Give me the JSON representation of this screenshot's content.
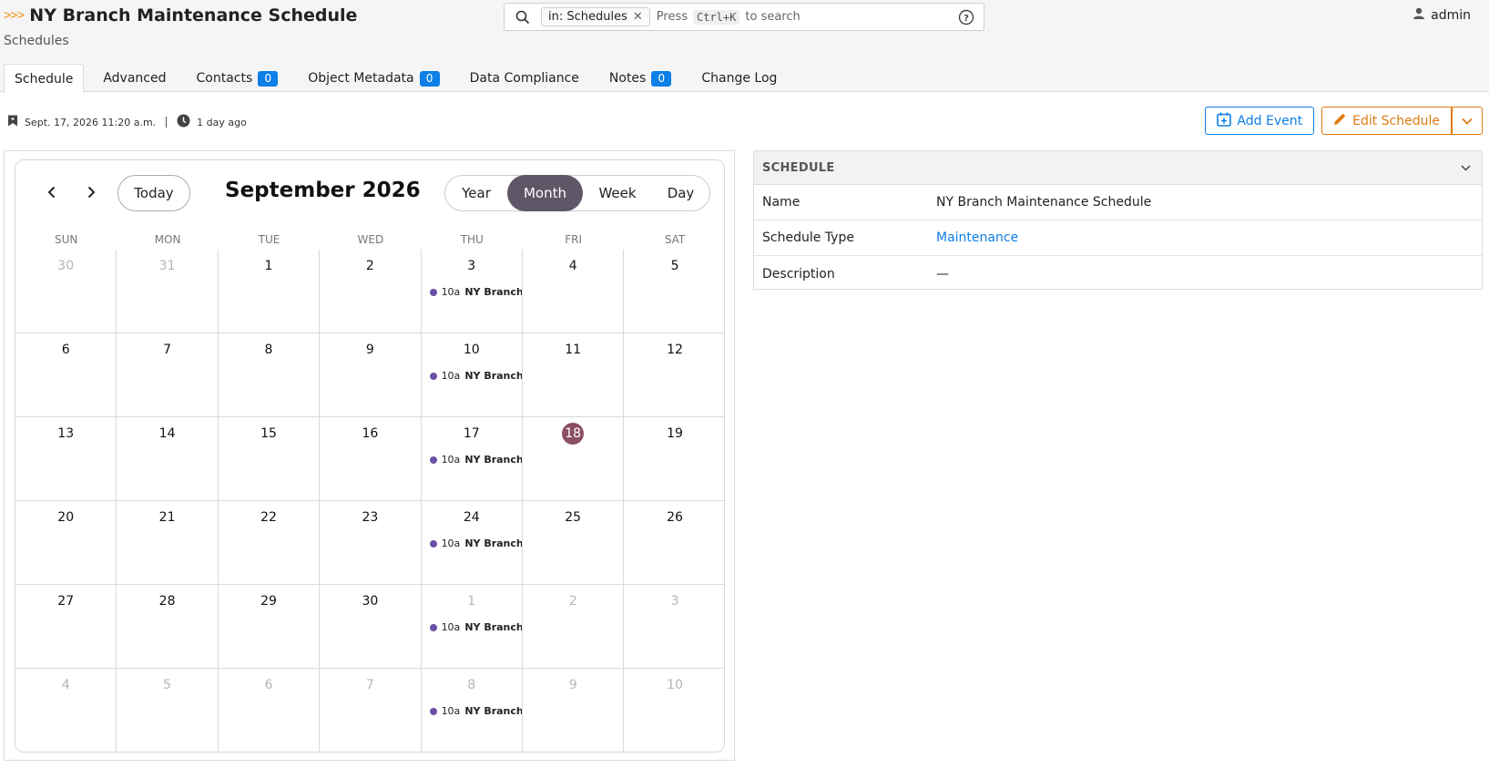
{
  "header": {
    "logo": ">>>",
    "title": "NY Branch Maintenance Schedule",
    "subtitle": "Schedules",
    "search": {
      "chip_label": "in: Schedules",
      "hint_prefix": "Press",
      "shortcut": "Ctrl+K",
      "hint_suffix": "to search"
    },
    "user": "admin"
  },
  "tabs": [
    {
      "label": "Schedule",
      "active": true
    },
    {
      "label": "Advanced"
    },
    {
      "label": "Contacts",
      "badge": "0"
    },
    {
      "label": "Object Metadata",
      "badge": "0"
    },
    {
      "label": "Data Compliance"
    },
    {
      "label": "Notes",
      "badge": "0"
    },
    {
      "label": "Change Log"
    }
  ],
  "meta": {
    "created": "Sept. 17, 2026 11:20 a.m.",
    "updated": "1 day ago"
  },
  "actions": {
    "add_event": "Add Event",
    "edit_schedule": "Edit Schedule"
  },
  "calendar": {
    "today_label": "Today",
    "title": "September 2026",
    "views": [
      "Year",
      "Month",
      "Week",
      "Day"
    ],
    "active_view": "Month",
    "dow": [
      "SUN",
      "MON",
      "TUE",
      "WED",
      "THU",
      "FRI",
      "SAT"
    ],
    "event_time": "10a",
    "event_title": "NY Branch Maintenance Schedule",
    "accent": "#6b4fa6",
    "today_color": "#8c4e63",
    "weeks": [
      [
        {
          "d": "30",
          "m": true
        },
        {
          "d": "31",
          "m": true
        },
        {
          "d": "1"
        },
        {
          "d": "2"
        },
        {
          "d": "3",
          "e": true
        },
        {
          "d": "4"
        },
        {
          "d": "5"
        }
      ],
      [
        {
          "d": "6"
        },
        {
          "d": "7"
        },
        {
          "d": "8"
        },
        {
          "d": "9"
        },
        {
          "d": "10",
          "e": true
        },
        {
          "d": "11"
        },
        {
          "d": "12"
        }
      ],
      [
        {
          "d": "13"
        },
        {
          "d": "14"
        },
        {
          "d": "15"
        },
        {
          "d": "16"
        },
        {
          "d": "17",
          "e": true
        },
        {
          "d": "18",
          "t": true
        },
        {
          "d": "19"
        }
      ],
      [
        {
          "d": "20"
        },
        {
          "d": "21"
        },
        {
          "d": "22"
        },
        {
          "d": "23"
        },
        {
          "d": "24",
          "e": true
        },
        {
          "d": "25"
        },
        {
          "d": "26"
        }
      ],
      [
        {
          "d": "27"
        },
        {
          "d": "28"
        },
        {
          "d": "29"
        },
        {
          "d": "30"
        },
        {
          "d": "1",
          "m": true,
          "e": true
        },
        {
          "d": "2",
          "m": true
        },
        {
          "d": "3",
          "m": true
        }
      ],
      [
        {
          "d": "4",
          "m": true
        },
        {
          "d": "5",
          "m": true
        },
        {
          "d": "6",
          "m": true
        },
        {
          "d": "7",
          "m": true
        },
        {
          "d": "8",
          "m": true,
          "e": true
        },
        {
          "d": "9",
          "m": true
        },
        {
          "d": "10",
          "m": true
        }
      ]
    ]
  },
  "panel": {
    "title": "SCHEDULE",
    "rows": [
      {
        "label": "Name",
        "value": "NY Branch Maintenance Schedule"
      },
      {
        "label": "Schedule Type",
        "value": "Maintenance",
        "link": true
      },
      {
        "label": "Description",
        "value": "—"
      }
    ]
  }
}
